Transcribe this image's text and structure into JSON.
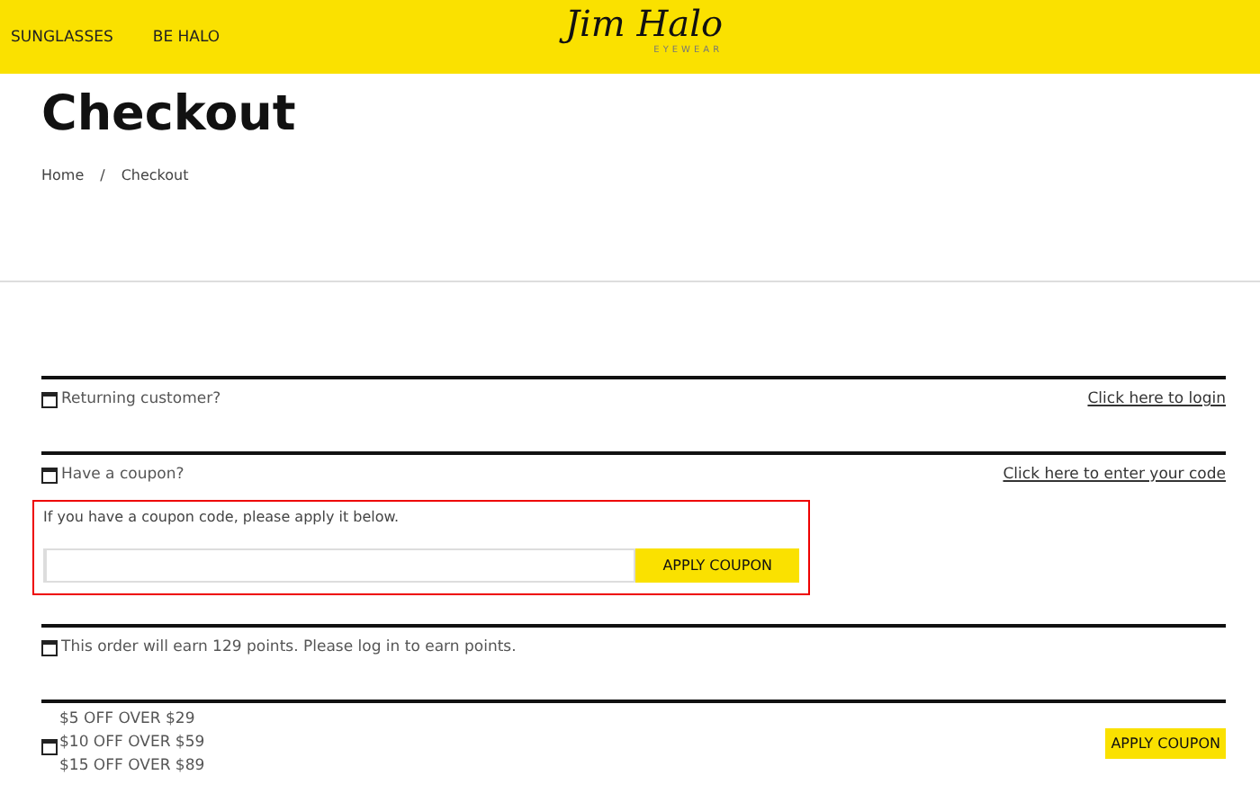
{
  "header": {
    "nav": [
      "SUNGLASSES",
      "BE HALO"
    ],
    "logo": {
      "script": "Jim Halo",
      "tagline": "EYEWEAR"
    }
  },
  "title": "Checkout",
  "breadcrumb": [
    "Home",
    "/",
    "Checkout"
  ],
  "notices": [
    {
      "text": "Returning customer?",
      "link": "Click here to login"
    },
    {
      "text": "Have a coupon?",
      "link": "Click here to enter your code"
    }
  ],
  "coupon_form": {
    "prompt": "If you have a coupon code, please apply it below.",
    "button": "APPLY COUPON"
  },
  "points_notice": {
    "text": "This order will earn 129 points. Please log in to earn points."
  },
  "offers": {
    "items": [
      "$5 OFF OVER $29",
      "$10 OFF OVER $59",
      "$15 OFF OVER $89"
    ],
    "button": "APPLY COUPON"
  }
}
